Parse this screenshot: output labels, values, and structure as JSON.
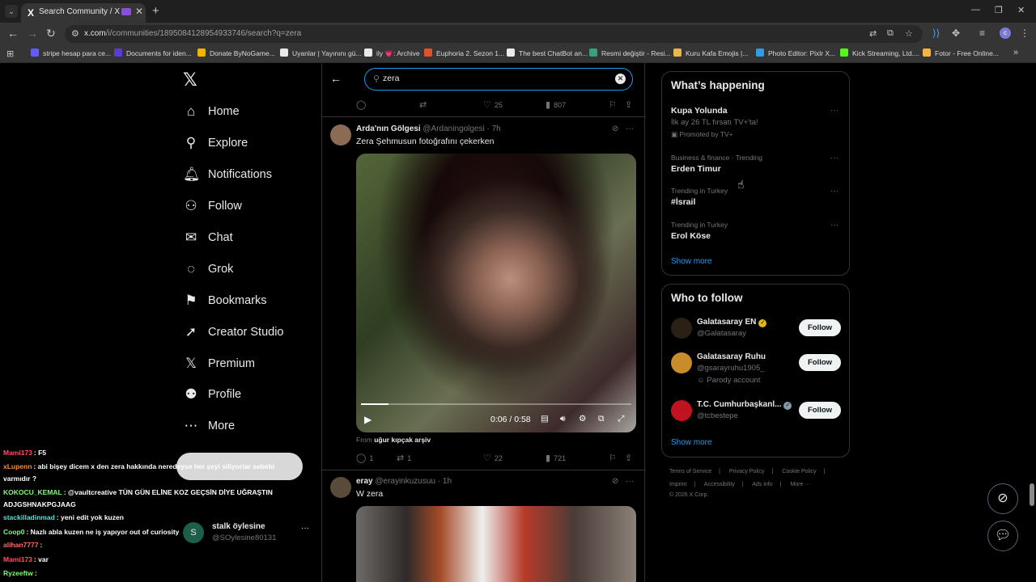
{
  "browser": {
    "tab": {
      "title": "Search Community / X",
      "favicon": "X"
    },
    "url": {
      "host": "x.com",
      "path": "/i/communities/1895084128954933746/search?q=zera"
    },
    "bookmarks": [
      {
        "label": "stripe hesap para ce...",
        "color": "#635bff"
      },
      {
        "label": "Documents for iden...",
        "color": "#5a3bd6"
      },
      {
        "label": "Donate ByNoGame...",
        "color": "#f0b400"
      },
      {
        "label": "Uyanlar | Yayınını gü...",
        "color": "#e7e9ea"
      },
      {
        "label": "ily 💗: Archive",
        "color": "#e7e9ea"
      },
      {
        "label": "Euphoria 2. Sezon 1...",
        "color": "#e2522a"
      },
      {
        "label": "The best ChatBot an...",
        "color": "#e7e9ea"
      },
      {
        "label": "Resmi değiştir - Resi...",
        "color": "#3aa07a"
      },
      {
        "label": "Kuru Kafa Emojis |...",
        "color": "#e8b84a"
      },
      {
        "label": "Photo Editor: Pixlr X...",
        "color": "#2f9de0"
      },
      {
        "label": "Kick Streaming, Ltd....",
        "color": "#53fc18"
      },
      {
        "label": "Fotor - Free Online...",
        "color": "#f5b73b"
      }
    ]
  },
  "nav": {
    "items": [
      {
        "label": "Home",
        "icon": "⌂"
      },
      {
        "label": "Explore",
        "icon": "⚲"
      },
      {
        "label": "Notifications",
        "icon": "🔔︎"
      },
      {
        "label": "Follow",
        "icon": "⚇"
      },
      {
        "label": "Chat",
        "icon": "✉"
      },
      {
        "label": "Grok",
        "icon": "◌"
      },
      {
        "label": "Bookmarks",
        "icon": "⚑"
      },
      {
        "label": "Creator Studio",
        "icon": "➚"
      },
      {
        "label": "Premium",
        "icon": "𝕏"
      },
      {
        "label": "Profile",
        "icon": "⚉"
      },
      {
        "label": "More",
        "icon": "⋯"
      }
    ]
  },
  "search": {
    "query": "zera"
  },
  "top_actions": {
    "replies": "",
    "reposts": "",
    "likes": "25",
    "views": "807"
  },
  "post1": {
    "name": "Arda'nın Gölgesi",
    "handle": "@Ardaningolgesi · 7h",
    "text": "Zera Şehmusun fotoğrafını çekerken",
    "video_time": "0:06 / 0:58",
    "video_progress": 0.103,
    "from_label": "From",
    "from_name": "uğur kıpçak arşiv",
    "actions": {
      "replies": "1",
      "reposts": "1",
      "likes": "22",
      "views": "721"
    }
  },
  "post2": {
    "name": "eray",
    "handle": "@erayinkuzusuu · 1h",
    "text": "W zera"
  },
  "trends": {
    "title": "What’s happening",
    "items": [
      {
        "title": "Kupa Yolunda",
        "sub": "İlk ay 26 TL fırsatı TV+'ta!",
        "promo": "Promoted by TV+"
      },
      {
        "meta": "Business & finance · Trending",
        "title": "Erden Timur"
      },
      {
        "meta": "Trending in Turkey",
        "title": "#İsrail"
      },
      {
        "meta": "Trending in Turkey",
        "title": "Erol Köse"
      }
    ],
    "show_more": "Show more"
  },
  "who_to_follow": {
    "title": "Who to follow",
    "accounts": [
      {
        "name": "Galatasaray EN",
        "handle": "@Galatasaray",
        "extra": "",
        "button": "Follow",
        "avatar_color": "#2a2014"
      },
      {
        "name": "Galatasaray Ruhu",
        "handle": "@gsarayruhu1905_",
        "extra": "Parody account",
        "button": "Follow",
        "avatar_color": "#c98c2a"
      },
      {
        "name": "T.C. Cumhurbaşkanl...",
        "handle": "@tcbestepe",
        "extra": "",
        "button": "Follow",
        "avatar_color": "#c1121f"
      }
    ],
    "show_more": "Show more"
  },
  "footer": {
    "row1": [
      "Terms of Service",
      "|",
      "Privacy Policy",
      "|",
      "Cookie Policy",
      "|"
    ],
    "row2": [
      "Imprint",
      "|",
      "Accessibility",
      "|",
      "Ads info",
      "|",
      "More ···"
    ],
    "copyright": "© 2026 X Corp."
  },
  "chat": [
    {
      "user": "Mami173",
      "color": "#ff4b6e",
      "msg": ": F5"
    },
    {
      "user": "xLupenn",
      "color": "#ff8c2e",
      "msg": ": abi bişey dicem x den zera hakkında neredeyse her şeyi siliyorlar sebebi"
    },
    {
      "user": "",
      "color": "#ffffff",
      "msg": "varmıdır ?"
    },
    {
      "user": "KOKOCU_KEMAL",
      "color": "#7cfc74",
      "msg": ": @vaultcreative TÜN GÜN ELİNE KOZ GEÇSİN DİYE UĞRAŞTIN"
    },
    {
      "user": "",
      "color": "#ffffff",
      "msg": "ADJGSHNAKPGJAAG"
    },
    {
      "user": "stackilladinmad",
      "color": "#5ce0d8",
      "msg": ": yeni edit yok kuzen"
    },
    {
      "user": "Coop0",
      "color": "#7cfc74",
      "msg": ": Nazlı abla kuzen ne iş yapıyor out of curiosity"
    },
    {
      "user": "alihan7777",
      "color": "#ff6b6b",
      "msg": ":"
    },
    {
      "user": "Mami173",
      "color": "#ff4b6e",
      "msg": ": var"
    },
    {
      "user": "Ryzeeftw",
      "color": "#7cfc74",
      "msg": ":"
    }
  ],
  "stalk": {
    "name": "stalk öylesine",
    "handle": "@SOylesine80131",
    "initial": "S"
  }
}
